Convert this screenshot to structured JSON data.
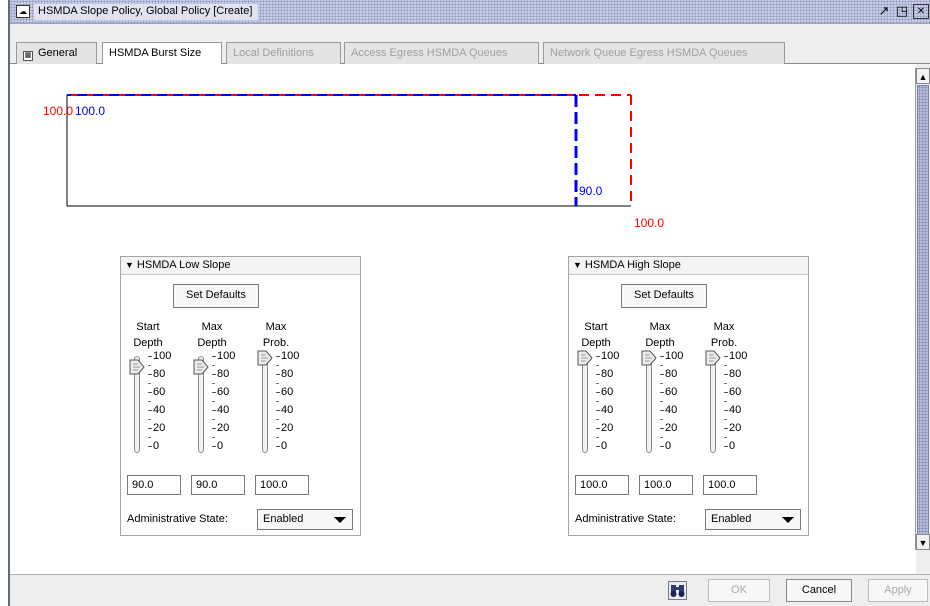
{
  "window": {
    "title": "HSMDA Slope Policy, Global Policy [Create]",
    "title_icon_text": "☁",
    "buttons": [
      "restore-icon",
      "maximize-icon",
      "close-icon"
    ]
  },
  "tabs": [
    {
      "label": "General",
      "icon": "general-icon",
      "state": "normal"
    },
    {
      "label": "HSMDA Burst Size",
      "state": "active"
    },
    {
      "label": "Local Definitions",
      "state": "disabled"
    },
    {
      "label": "Access Egress HSMDA Queues",
      "state": "disabled"
    },
    {
      "label": "Network Queue Egress HSMDA Queues",
      "state": "disabled"
    }
  ],
  "graph": {
    "red_top_label": "100.0",
    "blue_top_label": "100.0",
    "blue_bottom_label": "90.0",
    "red_bottom_label": "100.0",
    "colors": {
      "low": "#0000ff",
      "high": "#ff0000",
      "axis": "#000000"
    }
  },
  "low_slope": {
    "title": "HSMDA Low Slope",
    "set_defaults": "Set Defaults",
    "columns": [
      {
        "header1": "Start",
        "header2": "Depth",
        "value": "90.0",
        "level": 90
      },
      {
        "header1": "Max",
        "header2": "Depth",
        "value": "90.0",
        "level": 90
      },
      {
        "header1": "Max",
        "header2": "Prob.",
        "value": "100.0",
        "level": 100
      }
    ],
    "ticks": [
      "100",
      "80",
      "60",
      "40",
      "20",
      "0"
    ],
    "admin_label": "Administrative State:",
    "admin_value": "Enabled"
  },
  "high_slope": {
    "title": "HSMDA High Slope",
    "set_defaults": "Set Defaults",
    "columns": [
      {
        "header1": "Start",
        "header2": "Depth",
        "value": "100.0",
        "level": 100
      },
      {
        "header1": "Max",
        "header2": "Depth",
        "value": "100.0",
        "level": 100
      },
      {
        "header1": "Max",
        "header2": "Prob.",
        "value": "100.0",
        "level": 100
      }
    ],
    "ticks": [
      "100",
      "80",
      "60",
      "40",
      "20",
      "0"
    ],
    "admin_label": "Administrative State:",
    "admin_value": "Enabled"
  },
  "footer": {
    "ok": "OK",
    "cancel": "Cancel",
    "apply": "Apply"
  }
}
